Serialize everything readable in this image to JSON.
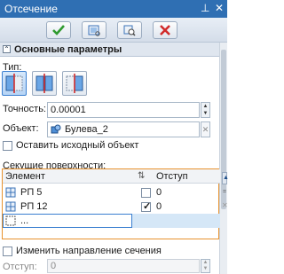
{
  "window": {
    "title": "Отсечение",
    "pin_glyph": "⊥",
    "close_glyph": "✕"
  },
  "toolbar": {
    "buttons": [
      {
        "name": "ok-button",
        "icon": "checkmark-icon",
        "color": "#2e9a2e"
      },
      {
        "name": "preview-button",
        "icon": "preview-icon",
        "color": "#3b73b8"
      },
      {
        "name": "zoom-preview-button",
        "icon": "zoom-icon",
        "color": "#3b73b8"
      },
      {
        "name": "cancel-button",
        "icon": "cross-icon",
        "color": "#d12b2b"
      }
    ]
  },
  "section": {
    "title": "Основные параметры",
    "collapse_glyph": "⌃"
  },
  "type": {
    "label": "Тип:",
    "options": [
      "cut-left",
      "cut-both",
      "cut-right"
    ],
    "selected_index": 0
  },
  "precision": {
    "label": "Точность:",
    "value": "0.00001"
  },
  "object": {
    "label": "Объект:",
    "value": "Булева_2"
  },
  "keep_original": {
    "label": "Оставить исходный объект",
    "checked": false
  },
  "surfaces": {
    "label": "Секущие поверхности:",
    "col_element": "Элемент",
    "col_offset": "Отступ",
    "rows": [
      {
        "name": "РП 5",
        "checked": false,
        "offset": "0"
      },
      {
        "name": "РП 12",
        "checked": true,
        "offset": "0"
      },
      {
        "name": "...",
        "checked": false,
        "offset": ""
      }
    ]
  },
  "flip_direction": {
    "label": "Изменить направление сечения",
    "checked": false
  },
  "offset": {
    "label": "Отступ:",
    "value": "0"
  },
  "colors": {
    "accent": "#2f6fb3",
    "grid_border": "#e8922e",
    "selected_row": "#d5e7f7"
  }
}
